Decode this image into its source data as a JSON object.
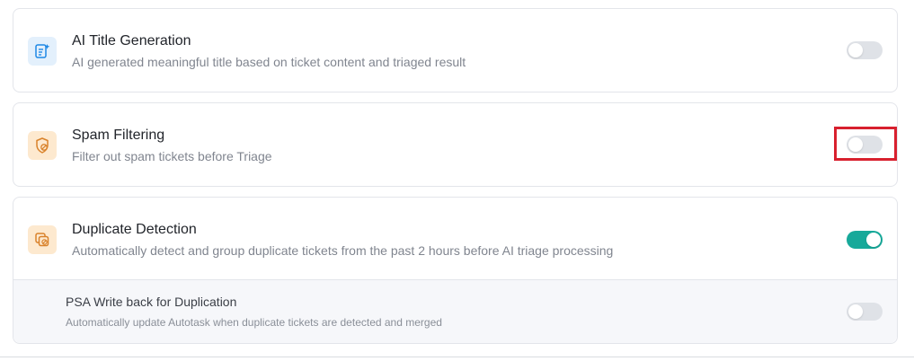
{
  "settings": [
    {
      "title": "AI Title Generation",
      "description": "AI generated meaningful title based on ticket content and triaged result",
      "icon": "ai-edit-document-icon",
      "enabled": false
    },
    {
      "title": "Spam Filtering",
      "description": "Filter out spam tickets before Triage",
      "icon": "shield-block-icon",
      "enabled": false
    },
    {
      "title": "Duplicate Detection",
      "description": "Automatically detect and group duplicate tickets from the past 2 hours before AI triage processing",
      "icon": "duplicate-block-icon",
      "enabled": true,
      "sub_setting": {
        "title": "PSA Write back for Duplication",
        "description": "Automatically update Autotask when duplicate tickets are detected and merged",
        "enabled": false
      }
    }
  ],
  "colors": {
    "toggle_on": "#17a99a",
    "toggle_off": "#dfe2e7",
    "highlight": "#d8202e",
    "icon_blue": "#1e88e5",
    "icon_orange": "#d9822b"
  }
}
